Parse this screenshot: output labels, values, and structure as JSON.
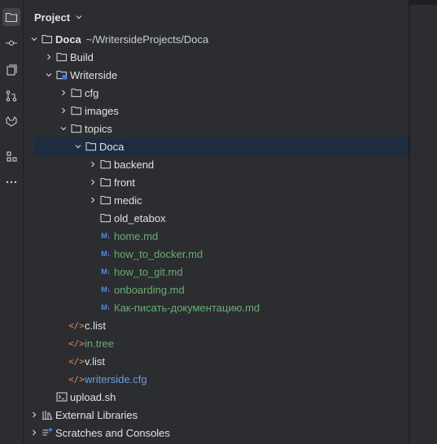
{
  "header": {
    "title": "Project"
  },
  "activity": [
    {
      "name": "project-icon",
      "active": true
    },
    {
      "name": "commit-icon",
      "active": false
    },
    {
      "name": "bookmarks-icon",
      "active": false
    },
    {
      "name": "pull-requests-icon",
      "active": false
    },
    {
      "name": "gitlab-icon",
      "active": false
    },
    {
      "name": "structure-icon",
      "active": false
    },
    {
      "name": "more-icon",
      "active": false
    }
  ],
  "tree": {
    "root": {
      "label": "Doca",
      "path": "~/WritersideProjects/Doca"
    },
    "build": {
      "label": "Build"
    },
    "writerside": {
      "label": "Writerside"
    },
    "cfg": {
      "label": "cfg"
    },
    "images": {
      "label": "images"
    },
    "topics": {
      "label": "topics"
    },
    "doca": {
      "label": "Doca"
    },
    "backend": {
      "label": "backend"
    },
    "front": {
      "label": "front"
    },
    "medic": {
      "label": "medic"
    },
    "old_etabox": {
      "label": "old_etabox"
    },
    "md_badge": "M↓",
    "home_md": {
      "label": "home.md"
    },
    "how_to_docker": {
      "label": "how_to_docker.md"
    },
    "how_to_git": {
      "label": "how_to_git.md"
    },
    "onboarding": {
      "label": "onboarding.md"
    },
    "kak_pisat": {
      "label": "Как-писать-документацию.md"
    },
    "xml_badge": "</>",
    "c_list": {
      "label": "c.list"
    },
    "in_tree": {
      "label": "in.tree"
    },
    "v_list": {
      "label": "v.list"
    },
    "writerside_cfg": {
      "label": "writerside.cfg"
    },
    "upload_sh": {
      "label": "upload.sh"
    },
    "external_libraries": {
      "label": "External Libraries"
    },
    "scratches": {
      "label": "Scratches and Consoles"
    }
  },
  "colors": {
    "background": "#2b2d30",
    "selection": "#1e2c3f",
    "green_text": "#6aab73",
    "blue_text": "#6a9fd8",
    "md_badge": "#548af7",
    "xml_badge": "#e08855"
  }
}
